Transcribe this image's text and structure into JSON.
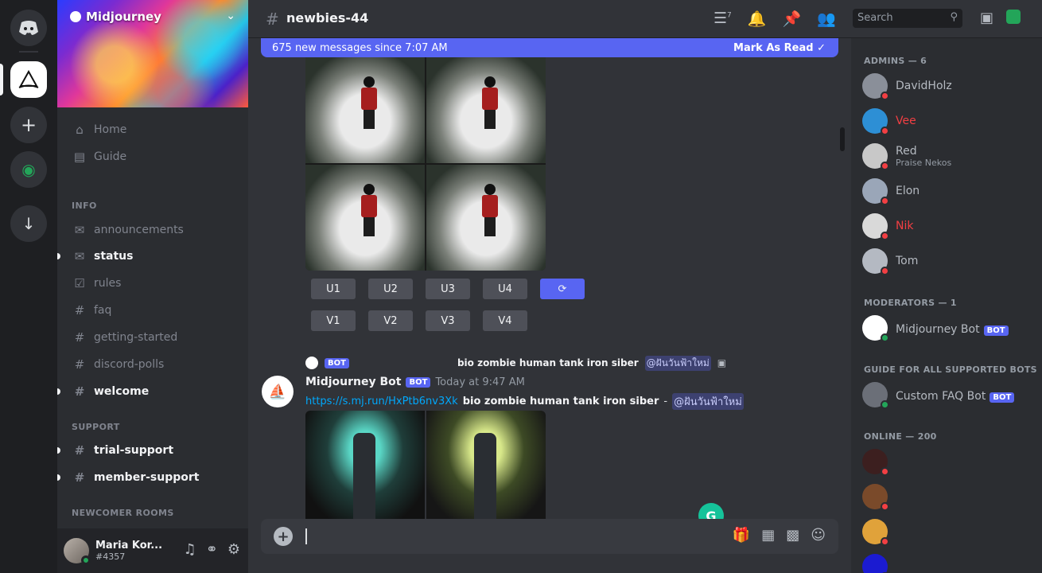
{
  "server": {
    "name": "Midjourney"
  },
  "channel_sidebar": {
    "top_items": [
      {
        "icon": "home-icon",
        "label": "Home"
      },
      {
        "icon": "browse-icon",
        "label": "Guide"
      }
    ],
    "categories": [
      {
        "label": "INFO"
      },
      {
        "label": "SUPPORT"
      },
      {
        "label": "NEWCOMER ROOMS"
      }
    ],
    "channels": [
      {
        "label": "announcements"
      },
      {
        "label": "status"
      },
      {
        "label": "rules"
      },
      {
        "label": "faq"
      },
      {
        "label": "getting-started"
      },
      {
        "label": "discord-polls"
      },
      {
        "label": "welcome"
      },
      {
        "label": "trial-support"
      },
      {
        "label": "member-support"
      }
    ]
  },
  "user": {
    "name": "Maria Kor...",
    "status": "#4357"
  },
  "header": {
    "channel": "newbies-44",
    "thread_count": "7",
    "search_placeholder": "Search"
  },
  "new_messages": {
    "text": "675 new messages since 7:07 AM",
    "action": "Mark As Read"
  },
  "upscale_buttons": [
    "U1",
    "U2",
    "U3",
    "U4"
  ],
  "variation_buttons": [
    "V1",
    "V2",
    "V3",
    "V4"
  ],
  "reply": {
    "tag": "BOT",
    "prompt": "bio zombie human tank iron siber",
    "mention": "@ฝันวันฟ้าใหม่"
  },
  "message": {
    "author": "Midjourney Bot",
    "tag": "BOT",
    "time": "Today at 9:47 AM",
    "link": "https://s.mj.run/HxPtb6nv3Xk",
    "prompt": "bio zombie human tank iron siber",
    "suffix": "-",
    "mention": "@ฝันวันฟ้าใหม่"
  },
  "members": {
    "categories": [
      {
        "label": "ADMINS — 6"
      },
      {
        "label": "MODERATORS — 1"
      },
      {
        "label": "GUIDE FOR ALL SUPPORTED BOTS"
      },
      {
        "label": "ONLINE — 200"
      }
    ],
    "list": [
      {
        "name": "DavidHolz",
        "sub": ""
      },
      {
        "name": "Vee",
        "sub": ""
      },
      {
        "name": "Red",
        "sub": "Praise Nekos"
      },
      {
        "name": "Elon",
        "sub": ""
      },
      {
        "name": "Nik",
        "sub": ""
      },
      {
        "name": "Tom",
        "sub": ""
      },
      {
        "name": "Midjourney Bot",
        "sub": "",
        "tag": "BOT"
      },
      {
        "name": "Custom FAQ Bot",
        "sub": "",
        "tag": "BOT"
      },
      {
        "name": "",
        "sub": ""
      },
      {
        "name": "",
        "sub": ""
      },
      {
        "name": "",
        "sub": ""
      },
      {
        "name": "",
        "sub": ""
      }
    ]
  }
}
